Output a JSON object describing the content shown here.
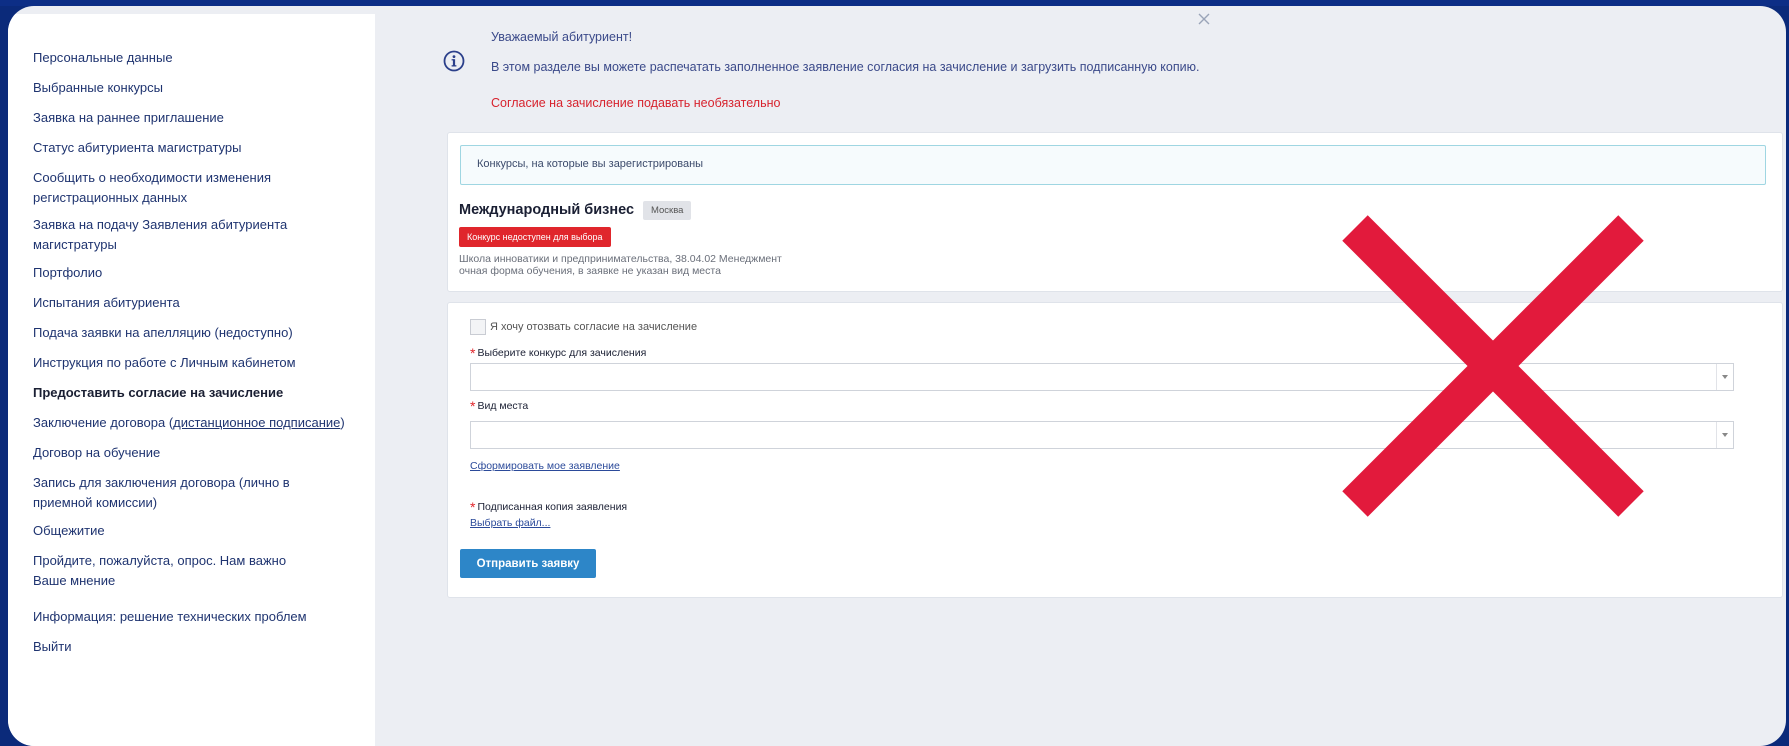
{
  "sidebar": {
    "items": [
      {
        "label": "Персональные данные"
      },
      {
        "label": "Выбранные конкурсы"
      },
      {
        "label": "Заявка на раннее приглашение"
      },
      {
        "label": "Статус абитуриента магистратуры"
      },
      {
        "label": "Сообщить о необходимости изменения регистрационных данных"
      },
      {
        "label": "Заявка на подачу Заявления абитуриента магистратуры"
      },
      {
        "label": "Портфолио"
      },
      {
        "label": "Испытания абитуриента"
      },
      {
        "label": "Подача заявки на апелляцию (недоступно)"
      },
      {
        "label": "Инструкция по работе с Личным кабинетом"
      },
      {
        "label": "Предоставить согласие на зачисление"
      },
      {
        "label_pre": "Заключение договора (",
        "label_link": "дистанционное подписание",
        "label_post": ")"
      },
      {
        "label": "Договор на обучение"
      },
      {
        "label": "Запись для заключения договора (лично в приемной комиссии)"
      },
      {
        "label": "Общежитие"
      },
      {
        "label": "Пройдите, пожалуйста, опрос. Нам важно Ваше мнение"
      },
      {
        "label": "Информация: решение технических проблем"
      },
      {
        "label": "Выйти"
      }
    ]
  },
  "notice": {
    "title": "Уважаемый абитуриент!",
    "text": "В этом разделе вы можете распечатать заполненное заявление согласия на зачисление и загрузить подписанную копию.",
    "warning": "Согласие на зачисление подавать необязательно"
  },
  "competitions": {
    "header": "Конкурсы, на которые вы зарегистрированы",
    "item": {
      "title": "Международный бизнес",
      "city": "Москва",
      "status": "Конкурс недоступен для выбора",
      "meta_line1": "Школа инноватики и предпринимательства,  38.04.02 Менеджмент",
      "meta_line2": "очная форма обучения,  в заявке не указан вид места"
    }
  },
  "form": {
    "withdraw_label": "Я хочу отозвать согласие на зачисление",
    "competition_label": "Выберите конкурс для зачисления",
    "place_type_label": "Вид места",
    "generate_link": "Сформировать мое заявление",
    "signed_copy_label": "Подписанная копия заявления",
    "choose_file_link": "Выбрать файл...",
    "submit_label": "Отправить заявку",
    "required_mark": "*"
  },
  "colors": {
    "background": "#0b2a7a",
    "accent_blue": "#2d86c8",
    "danger_red": "#e0262c",
    "overlay_x": "#e21a3c"
  }
}
